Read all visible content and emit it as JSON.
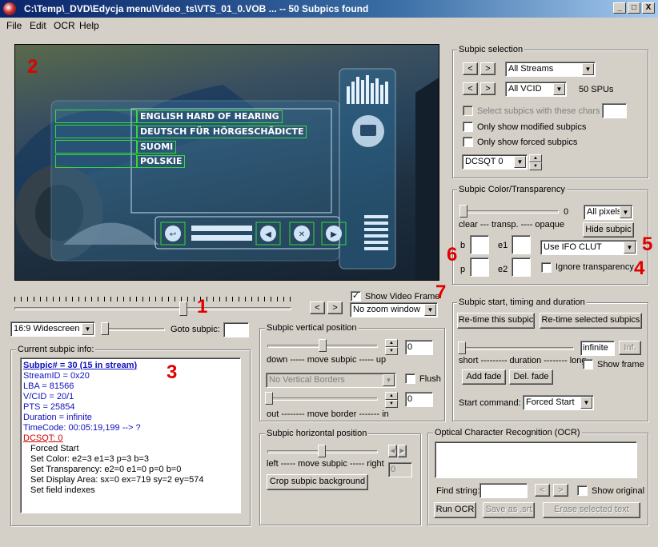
{
  "window": {
    "title": "C:\\Temp\\_DVD\\Edycja menu\\Video_ts\\VTS_01_0.VOB ... -- 50 Subpics found",
    "minimize": "_",
    "maximize": "□",
    "close": "X"
  },
  "menu": [
    "File",
    "Edit",
    "OCR",
    "Help"
  ],
  "annotations": [
    "1",
    "2",
    "3",
    "4",
    "5",
    "6",
    "7"
  ],
  "preview": {
    "subtitles": [
      "ENGLISH HARD OF HEARING",
      "DEUTSCH FÜR HÖRGESCHÄDICTE",
      "SUOMI",
      "POLSKIE"
    ]
  },
  "player": {
    "nav_prev": "<",
    "nav_next": ">",
    "show_video_frame": "Show Video Frame",
    "show_video_frame_checked": true,
    "zoom": "No zoom window",
    "aspect": "16:9 Widescreen",
    "goto_label": "Goto subpic:",
    "goto_value": ""
  },
  "subpic_selection": {
    "title": "Subpic selection",
    "stream": "All Streams",
    "vcid": "All VCID",
    "spu_count": "50 SPUs",
    "select_chars": "Select subpics with these chars",
    "only_modified": "Only show modified subpics",
    "only_forced": "Only show forced subpics",
    "dcsqt": "DCSQT 0",
    "arrow_left": "<",
    "arrow_right": ">"
  },
  "color": {
    "title": "Subpic Color/Transparency",
    "value": "0",
    "pixels": "All pixels",
    "scale": "clear --- transp. ---- opaque",
    "hide": "Hide subpic",
    "clut": "Use IFO CLUT",
    "ignore": "Ignore transparency",
    "b": "b",
    "e1": "e1",
    "p": "p",
    "e2": "e2"
  },
  "current_info": {
    "title": "Current subpic info:",
    "header": "Subpic# = 30 (15 in stream)",
    "lines": [
      "StreamID = 0x20",
      "LBA = 81566",
      "V/CID = 20/1",
      "PTS = 25854",
      "Duration = infinite",
      "TimeCode: 00:05:19,199 --> ?"
    ],
    "dcsq": "DCSQT: 0",
    "commands": [
      "Forced Start",
      "Set Color: e2=3 e1=3 p=3 b=3",
      "Set Transparency: e2=0 e1=0 p=0 b=0",
      "Set Display Area: sx=0 ex=719 sy=2 ey=574",
      "Set field indexes"
    ]
  },
  "vertical": {
    "title": "Subpic vertical position",
    "value": "0",
    "scale": "down ----- move subpic ----- up",
    "borders": "No Vertical Borders",
    "flush": "Flush",
    "border_value": "0",
    "border_scale": "out -------- move border ------- in"
  },
  "horizontal": {
    "title": "Subpic horizontal position",
    "scale": "left ----- move subpic ----- right",
    "value": "0",
    "crop": "Crop subpic background"
  },
  "timing": {
    "title": "Subpic start, timing and duration",
    "retime": "Re-time this subpic",
    "retime_sel": "Re-time selected subpics",
    "duration": "infinite",
    "inf": "Inf.",
    "scale": "short --------- duration -------- long",
    "show_frame": "Show frame",
    "add_fade": "Add fade",
    "del_fade": "Del. fade",
    "start_label": "Start command:",
    "start_value": "Forced Start"
  },
  "ocr": {
    "title": "Optical Character Recognition (OCR)",
    "find": "Find string:",
    "show_original": "Show original",
    "run": "Run OCR",
    "save": "Save as .srt",
    "erase": "Erase selected text"
  }
}
